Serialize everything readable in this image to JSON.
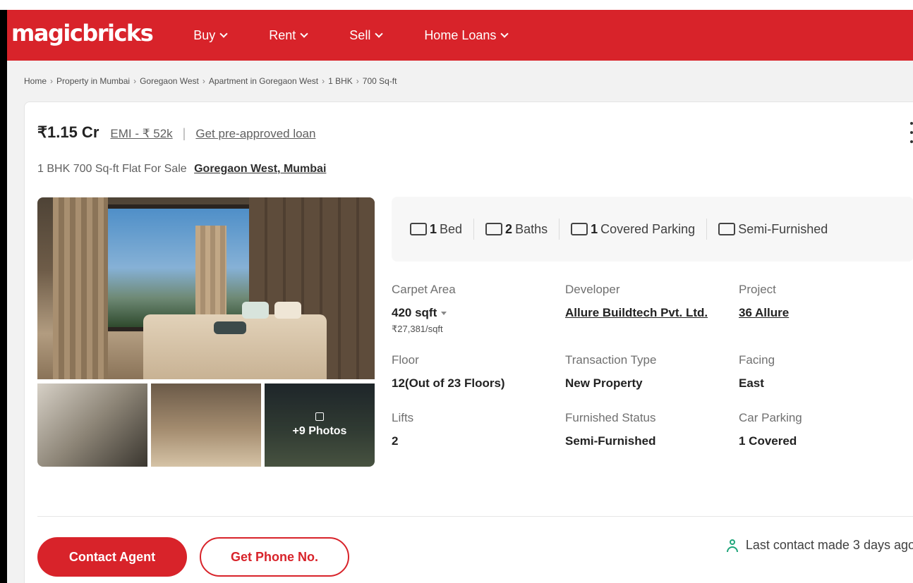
{
  "header": {
    "logo": "magicbricks",
    "nav": [
      {
        "label": "Buy"
      },
      {
        "label": "Rent"
      },
      {
        "label": "Sell"
      },
      {
        "label": "Home Loans"
      }
    ],
    "brand_color": "#d8232a"
  },
  "breadcrumb": [
    "Home",
    "Property in Mumbai",
    "Goregaon West",
    "Apartment in Goregaon West",
    "1 BHK",
    "700 Sq-ft"
  ],
  "listing": {
    "price": "₹1.15 Cr",
    "emi": "EMI - ₹ 52k",
    "loan_link": "Get pre-approved loan",
    "subtitle": "1 BHK 700 Sq-ft Flat For Sale",
    "location": "Goregaon West, Mumbai"
  },
  "gallery": {
    "more_photos": "+9 Photos"
  },
  "amenities": [
    {
      "value": "1",
      "label": "Bed",
      "icon": "bed-icon"
    },
    {
      "value": "2",
      "label": "Baths",
      "icon": "bath-icon"
    },
    {
      "value": "1",
      "label": "Covered Parking",
      "icon": "car-icon"
    },
    {
      "value": "",
      "label": "Semi-Furnished",
      "icon": "furniture-icon"
    }
  ],
  "details": {
    "carpet_area": {
      "label": "Carpet Area",
      "value": "420 sqft",
      "sub": "₹27,381/sqft"
    },
    "developer": {
      "label": "Developer",
      "value": "Allure Buildtech Pvt. Ltd."
    },
    "project": {
      "label": "Project",
      "value": "36 Allure"
    },
    "floor": {
      "label": "Floor",
      "value": "12(Out of 23 Floors)"
    },
    "transaction": {
      "label": "Transaction Type",
      "value": "New Property"
    },
    "facing": {
      "label": "Facing",
      "value": "East"
    },
    "lifts": {
      "label": "Lifts",
      "value": "2"
    },
    "furnished": {
      "label": "Furnished Status",
      "value": "Semi-Furnished"
    },
    "car_parking": {
      "label": "Car Parking",
      "value": "1 Covered"
    }
  },
  "actions": {
    "contact_agent": "Contact Agent",
    "get_phone": "Get Phone No.",
    "last_contact": "Last contact made 3 days ago"
  }
}
